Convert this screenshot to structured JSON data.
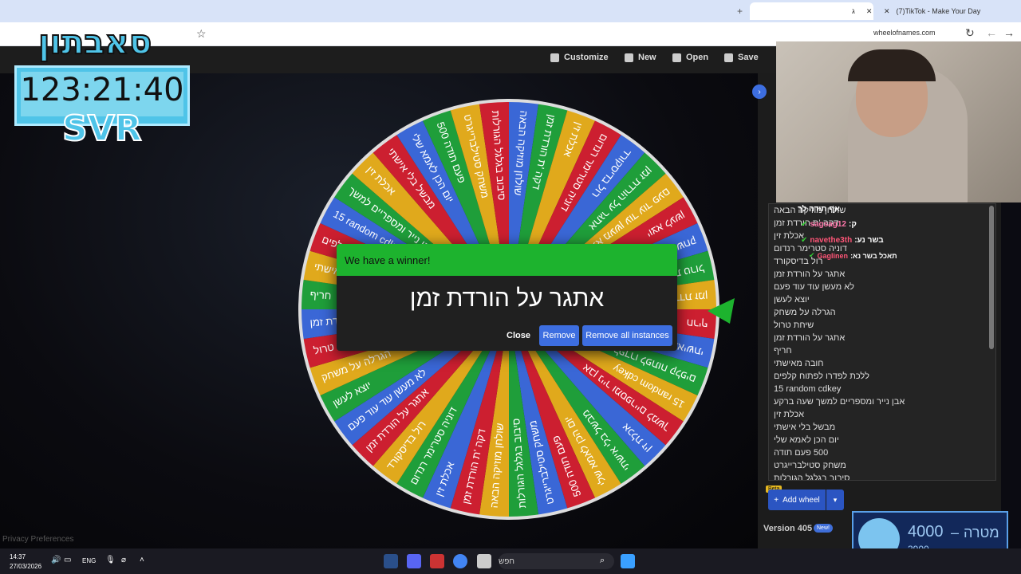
{
  "browser": {
    "tabs": [
      {
        "label": "ג",
        "active": true
      },
      {
        "label": "(7)TikTok - Make Your Day",
        "active": false
      }
    ],
    "url": "wheelofnames.com"
  },
  "toolbar": {
    "customize": "Customize",
    "new": "New",
    "open": "Open",
    "save": "Save"
  },
  "wheel": {
    "colors": [
      "#3a67d6",
      "#1f9e3a",
      "#e0a91c",
      "#cc1f30"
    ]
  },
  "dialog": {
    "header": "We have a winner!",
    "result": "אתגר על הורדת זמן",
    "close": "Close",
    "remove": "Remove",
    "remove_all": "Remove all instances"
  },
  "entries": [
    "שולחן מוזיקה הבאה",
    "דקה 'ת הורדת זמן",
    "אכלת זין",
    "דוניה סטרימר רנדום",
    "רול בדיסקורד",
    "אתגר על הורדת זמן",
    "לא מעשן עוד עוד פעם",
    "יוצא לעשן",
    "הגרלה על משחק",
    "שיחת טרול",
    "אתגר על הורדת זמן",
    "חריף",
    "חובה מאישתי",
    "ללכת לפדרו לפתוח קלפים",
    "15 random cdkey",
    "אבן נייר ומספריים למשך שעה ברקע",
    "אכלת זין",
    "מבשל בלי אישתי",
    "יום הכן לאמא שלי",
    "500 פעם תודה",
    "משחק סטילברייגרט",
    "סיבוב בגלגל הגורלות"
  ],
  "chat": [
    {
      "text": "אף תודה לך"
    },
    {
      "user": "sagsag12",
      "text": "ק:"
    },
    {
      "user": "navethe3th",
      "text": "בשר נע:"
    },
    {
      "user": "Gaglinen",
      "text": "תאכל בשר נא:"
    }
  ],
  "side": {
    "add_wheel": "Add wheel",
    "beta": "Beta",
    "version": "Version 405",
    "new_badge": "New!"
  },
  "overlay": {
    "banner": "סאבתון",
    "timer": "123:21:40",
    "svr": "SVR",
    "goal_current": "4000",
    "goal_label": "מטרה",
    "goal_target": "3900"
  },
  "privacy": "Privacy Preferences",
  "taskbar": {
    "time": "14:37",
    "date": "27/03/2026",
    "lang": "ENG",
    "search": "חפש"
  }
}
